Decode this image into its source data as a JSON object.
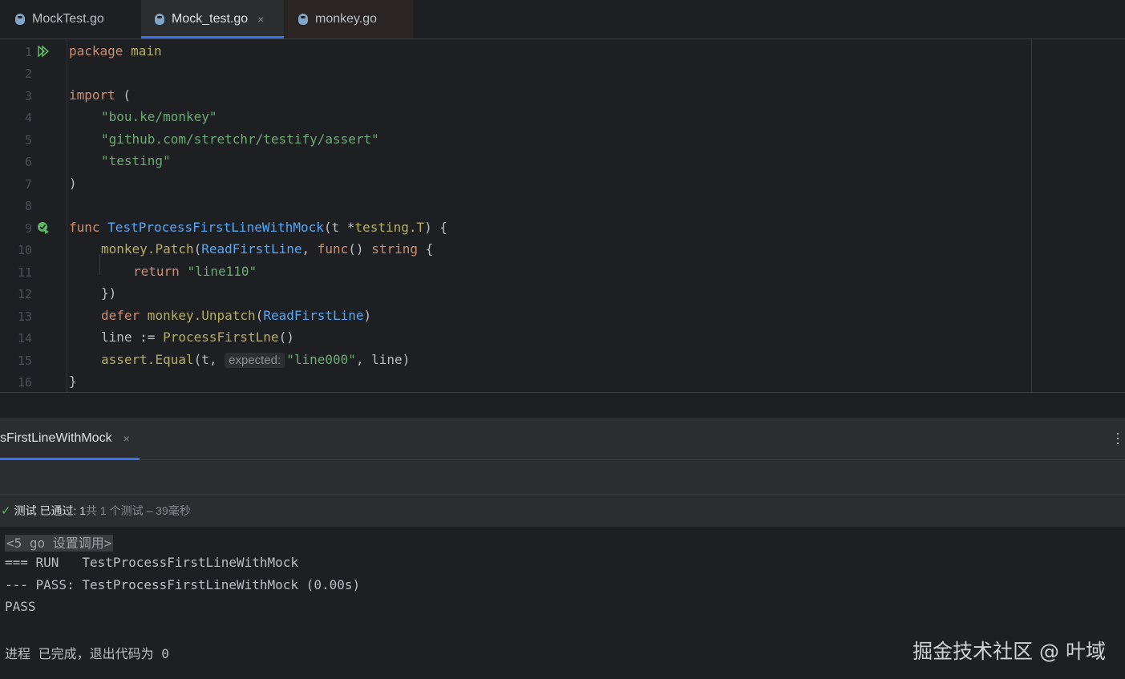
{
  "tabs": [
    {
      "label": "MockTest.go"
    },
    {
      "label": "Mock_test.go",
      "close": "×"
    },
    {
      "label": "monkey.go"
    }
  ],
  "editor": {
    "line_numbers": [
      "1",
      "2",
      "3",
      "4",
      "5",
      "6",
      "7",
      "8",
      "9",
      "10",
      "11",
      "12",
      "13",
      "14",
      "15",
      "16"
    ],
    "code": {
      "l1_kw": "package",
      "l1_name": "main",
      "l3_kw": "import",
      "l3_paren": " (",
      "l4": "\"bou.ke/monkey\"",
      "l5": "\"github.com/stretchr/testify/assert\"",
      "l6": "\"testing\"",
      "l7": ")",
      "l9_kw": "func",
      "l9_name": "TestProcessFirstLineWithMock",
      "l9_params_a": "(t *",
      "l9_type": "testing.T",
      "l9_params_b": ") {",
      "l10_pkg": "monkey.",
      "l10_fn": "Patch",
      "l10_a": "(",
      "l10_arg": "ReadFirstLine",
      "l10_b": ", ",
      "l10_kw": "func",
      "l10_c": "() ",
      "l10_type": "string",
      "l10_d": " {",
      "l11_kw": "return",
      "l11_str": "\"line110\"",
      "l12": "})",
      "l13_kw": "defer",
      "l13_pkg": " monkey.",
      "l13_fn": "Unpatch",
      "l13_a": "(",
      "l13_arg": "ReadFirstLine",
      "l13_b": ")",
      "l14_a": "line := ",
      "l14_fn": "ProcessFirstLne",
      "l14_b": "()",
      "l15_pkg": "assert.",
      "l15_fn": "Equal",
      "l15_a": "(t, ",
      "l15_hint": "expected:",
      "l15_str": "\"line000\"",
      "l15_b": ", line)",
      "l16": "}"
    }
  },
  "tool_window": {
    "tab_label": "sFirstLineWithMock",
    "tab_close": "×",
    "status_passed": "测试 已通过: 1",
    "status_meta": "共 1 个测试 – 39毫秒",
    "console": {
      "cmd": "<5 go 设置调用>",
      "run": "=== RUN   TestProcessFirstLineWithMock",
      "pass_line": "--- PASS: TestProcessFirstLineWithMock (0.00s)",
      "pass": "PASS",
      "exit": "进程 已完成，退出代码为 0"
    }
  },
  "watermark": "掘金技术社区 @ 叶域",
  "icons": [
    "gopher-file-icon",
    "run-gutter-icon",
    "test-passed-gutter-icon",
    "check-icon",
    "kebab-menu-icon"
  ],
  "colors": {
    "keyword": "#cf8e6d",
    "string": "#6aab73",
    "function": "#56a8f5",
    "accent": "#3574f0",
    "pass": "#5fb865"
  }
}
